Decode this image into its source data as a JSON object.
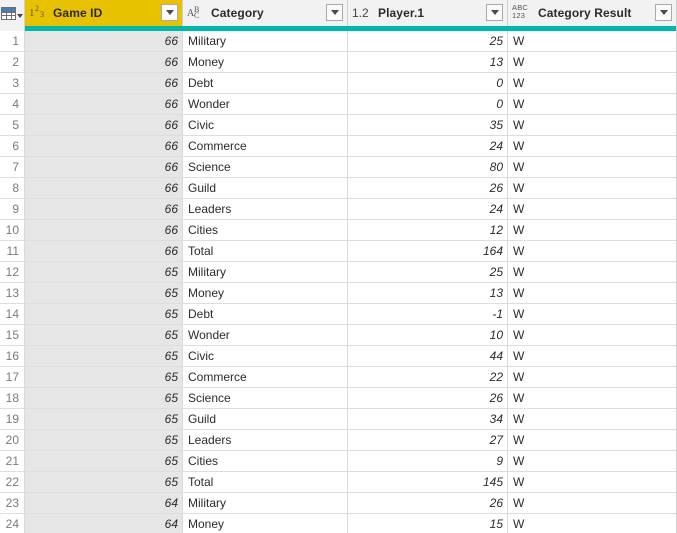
{
  "grid": {
    "corner_icon": "table-grid-icon",
    "columns": [
      {
        "name": "Game ID",
        "type_icon": "whole-number-icon",
        "type_icon_text": "1 2 3",
        "selected": true,
        "has_filter": true
      },
      {
        "name": "Category",
        "type_icon": "text-abc-icon",
        "type_icon_text": "A B C",
        "selected": false,
        "has_filter": true
      },
      {
        "name": "Player.1",
        "type_icon": "decimal-number-icon",
        "type_icon_text": "1.2",
        "selected": false,
        "has_filter": true
      },
      {
        "name": "Category Result",
        "type_icon": "any-type-icon",
        "type_icon_text": "ABC 123",
        "selected": false,
        "has_filter": true
      }
    ],
    "rows": [
      {
        "n": "1",
        "game_id": "66",
        "category": "Military",
        "player1": "25",
        "category_result": "W"
      },
      {
        "n": "2",
        "game_id": "66",
        "category": "Money",
        "player1": "13",
        "category_result": "W"
      },
      {
        "n": "3",
        "game_id": "66",
        "category": "Debt",
        "player1": "0",
        "category_result": "W"
      },
      {
        "n": "4",
        "game_id": "66",
        "category": "Wonder",
        "player1": "0",
        "category_result": "W"
      },
      {
        "n": "5",
        "game_id": "66",
        "category": "Civic",
        "player1": "35",
        "category_result": "W"
      },
      {
        "n": "6",
        "game_id": "66",
        "category": "Commerce",
        "player1": "24",
        "category_result": "W"
      },
      {
        "n": "7",
        "game_id": "66",
        "category": "Science",
        "player1": "80",
        "category_result": "W"
      },
      {
        "n": "8",
        "game_id": "66",
        "category": "Guild",
        "player1": "26",
        "category_result": "W"
      },
      {
        "n": "9",
        "game_id": "66",
        "category": "Leaders",
        "player1": "24",
        "category_result": "W"
      },
      {
        "n": "10",
        "game_id": "66",
        "category": "Cities",
        "player1": "12",
        "category_result": "W"
      },
      {
        "n": "11",
        "game_id": "66",
        "category": "Total",
        "player1": "164",
        "category_result": "W"
      },
      {
        "n": "12",
        "game_id": "65",
        "category": "Military",
        "player1": "25",
        "category_result": "W"
      },
      {
        "n": "13",
        "game_id": "65",
        "category": "Money",
        "player1": "13",
        "category_result": "W"
      },
      {
        "n": "14",
        "game_id": "65",
        "category": "Debt",
        "player1": "-1",
        "category_result": "W"
      },
      {
        "n": "15",
        "game_id": "65",
        "category": "Wonder",
        "player1": "10",
        "category_result": "W"
      },
      {
        "n": "16",
        "game_id": "65",
        "category": "Civic",
        "player1": "44",
        "category_result": "W"
      },
      {
        "n": "17",
        "game_id": "65",
        "category": "Commerce",
        "player1": "22",
        "category_result": "W"
      },
      {
        "n": "18",
        "game_id": "65",
        "category": "Science",
        "player1": "26",
        "category_result": "W"
      },
      {
        "n": "19",
        "game_id": "65",
        "category": "Guild",
        "player1": "34",
        "category_result": "W"
      },
      {
        "n": "20",
        "game_id": "65",
        "category": "Leaders",
        "player1": "27",
        "category_result": "W"
      },
      {
        "n": "21",
        "game_id": "65",
        "category": "Cities",
        "player1": "9",
        "category_result": "W"
      },
      {
        "n": "22",
        "game_id": "65",
        "category": "Total",
        "player1": "145",
        "category_result": "W"
      },
      {
        "n": "23",
        "game_id": "64",
        "category": "Military",
        "player1": "26",
        "category_result": "W"
      },
      {
        "n": "24",
        "game_id": "64",
        "category": "Money",
        "player1": "15",
        "category_result": "W"
      }
    ]
  },
  "colors": {
    "selected_header": "#e8c200",
    "accent_bar": "#00b7ac",
    "header_bg": "#f2f2f2",
    "selected_column_bg": "#e6e6e6"
  }
}
